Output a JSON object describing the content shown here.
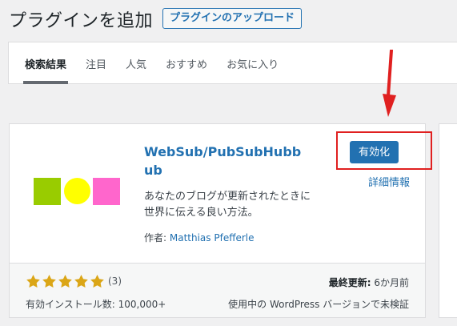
{
  "header": {
    "title": "プラグインを追加",
    "upload_button": "プラグインのアップロード"
  },
  "tabs": [
    {
      "label": "検索結果",
      "active": true
    },
    {
      "label": "注目",
      "active": false
    },
    {
      "label": "人気",
      "active": false
    },
    {
      "label": "おすすめ",
      "active": false
    },
    {
      "label": "お気に入り",
      "active": false
    }
  ],
  "plugin": {
    "name": "WebSub/PubSubHubbub",
    "activate_button": "有効化",
    "details_link": "詳細情報",
    "description": "あなたのブログが更新されたときに世界に伝える良い方法。",
    "author_label": "作者:",
    "author_name": "Matthias Pfefferle",
    "rating_stars": 5,
    "rating_count": "(3)",
    "installs": "有効インストール数: 100,000+",
    "last_updated_label": "最終更新:",
    "last_updated_value": "6か月前",
    "compatibility": "使用中の WordPress バージョンで未検証"
  },
  "colors": {
    "accent": "#2271b1",
    "highlight_box": "#e02020",
    "star": "#dba617",
    "icon_green": "#99cc00",
    "icon_yellow": "#ffff00",
    "icon_pink": "#ff66cc"
  }
}
